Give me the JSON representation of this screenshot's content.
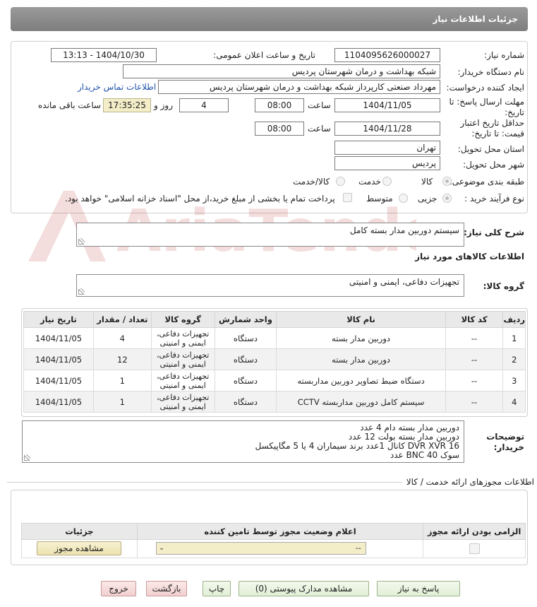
{
  "header": {
    "title": "جزئیات اطلاعات نیاز"
  },
  "form": {
    "need_number_label": "شماره نیاز:",
    "need_number": "1104095626000027",
    "announce_label": "تاریخ و ساعت اعلان عمومی:",
    "announce_value": "1404/10/30 - 13:13",
    "buyer_org_label": "نام دستگاه خریدار:",
    "buyer_org": "شبکه بهداشت و درمان شهرستان پردیس",
    "requester_label": "ایجاد کننده درخواست:",
    "requester": "مهرداد صنعتی کارپرداز شبکه بهداشت و درمان شهرستان پردیس",
    "contact_link": "اطلاعات تماس خریدار",
    "deadline_label_1": "مهلت ارسال پاسخ: تا",
    "deadline_label_2": "تاریخ:",
    "deadline_date": "1404/11/05",
    "time_label": "ساعت",
    "deadline_time": "08:00",
    "days_value": "4",
    "days_label": "روز و",
    "remaining_time": "17:35:25",
    "remaining_label": "ساعت باقی مانده",
    "validity_label_1": "حداقل تاریخ اعتبار",
    "validity_label_2": "قیمت: تا تاریخ:",
    "validity_date": "1404/11/28",
    "validity_time_label": "ساعت",
    "validity_time": "08:00",
    "province_label": "استان محل تحویل:",
    "province": "تهران",
    "city_label": "شهر محل تحویل:",
    "city": "پردیس",
    "category_label": "طبقه بندی موضوعی:",
    "category_options": [
      "کالا",
      "خدمت",
      "کالا/خدمت"
    ],
    "process_label": "نوع فرآیند خرید :",
    "process_options": [
      "جزیی",
      "متوسط"
    ],
    "payment_note": "پرداخت تمام یا بخشی از مبلغ خرید،از محل \"اسناد خزانه اسلامی\" خواهد بود."
  },
  "description": {
    "label": "شرح کلی نیاز:",
    "value": "سیستم دوربین مدار بسته کامل"
  },
  "goods_section_title": "اطلاعات کالاهای مورد نیاز",
  "goods_group": {
    "label": "گروه کالا:",
    "value": "تجهیزات دفاعی، ایمنی و امنیتی"
  },
  "items_table": {
    "headers": [
      "ردیف",
      "کد کالا",
      "نام کالا",
      "واحد شمارش",
      "گروه کالا",
      "تعداد / مقدار",
      "تاریخ نیاز"
    ],
    "rows": [
      [
        "1",
        "--",
        "دوربین مدار بسته",
        "دستگاه",
        "تجهیزات دفاعی، ایمنی و امنیتی",
        "4",
        "1404/11/05"
      ],
      [
        "2",
        "--",
        "دوربین مدار بسته",
        "دستگاه",
        "تجهیزات دفاعی، ایمنی و امنیتی",
        "12",
        "1404/11/05"
      ],
      [
        "3",
        "--",
        "دستگاه ضبط تصاویر دوربین مداربسته",
        "دستگاه",
        "تجهیزات دفاعی، ایمنی و امنیتی",
        "1",
        "1404/11/05"
      ],
      [
        "4",
        "--",
        "سیستم کامل دوربین مداربسته CCTV",
        "دستگاه",
        "تجهیزات دفاعی، ایمنی و امنیتی",
        "1",
        "1404/11/05"
      ]
    ]
  },
  "buyer_notes": {
    "label_1": "توضیحات",
    "label_2": "خریدار:",
    "lines": [
      "دوربین مدار بسته دام 4 عدد",
      "دوربین مدار بسته بولت 12 عدد",
      "DVR XVR  16 کانال 1عدد برند سیماران 4 یا 5 مگاپیکسل",
      "سوک BNC 40 عدد"
    ]
  },
  "permits": {
    "title": "اطلاعات مجوزهای ارائه خدمت / کالا",
    "headers": [
      "الزامی بودن ارائه مجوز",
      "اعلام وضعیت مجوز توسط تامین کننده",
      "جزئیات"
    ],
    "select_value": "--",
    "view_button": "مشاهده مجوز"
  },
  "buttons": {
    "reply": "پاسخ به نیاز",
    "view_docs": "مشاهده مدارک پیوستی (0)",
    "print": "چاپ",
    "back": "بازگشت",
    "exit": "خروج"
  },
  "watermark": "AriaTender.net"
}
